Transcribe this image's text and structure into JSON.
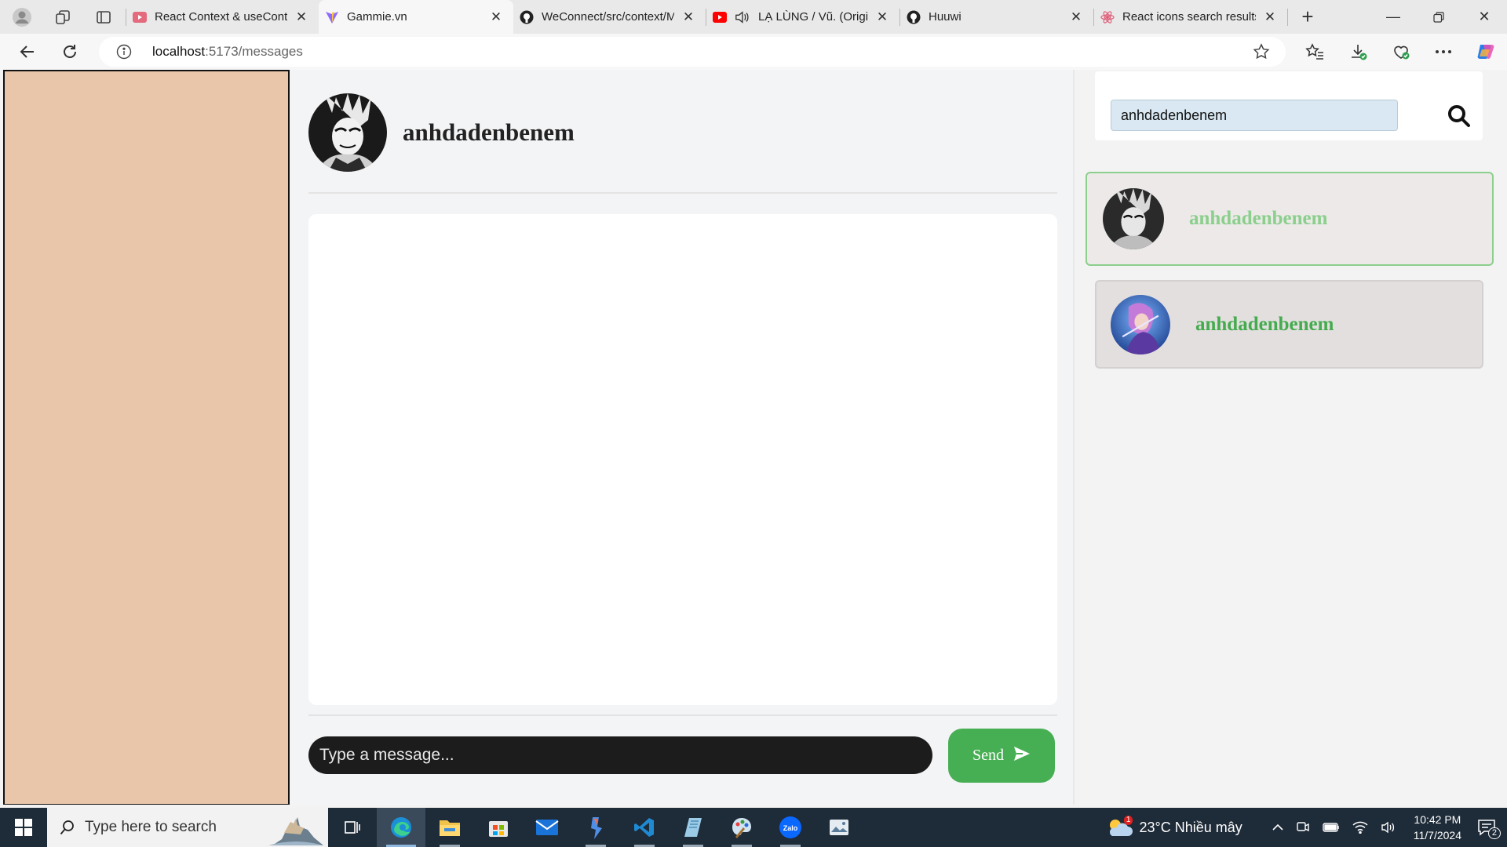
{
  "browser": {
    "tabs": [
      {
        "title": "React Context & useContext",
        "active": false,
        "icon": "youtube-icon"
      },
      {
        "title": "Gammie.vn",
        "active": true,
        "icon": "vite-icon"
      },
      {
        "title": "WeConnect/src/context/MessageContext",
        "active": false,
        "icon": "github-icon"
      },
      {
        "title": "LẠ LÙNG / Vũ. (Original)",
        "active": false,
        "icon": "youtube-icon"
      },
      {
        "title": "Huuwi",
        "active": false,
        "icon": "github-icon"
      },
      {
        "title": "React icons search results",
        "active": false,
        "icon": "react-icon"
      }
    ],
    "url_host": "localhost",
    "url_path": ":5173/messages"
  },
  "chat": {
    "header_name": "anhdadenbenem",
    "input_placeholder": "Type a message...",
    "send_label": "Send"
  },
  "search": {
    "value": "anhdadenbenem"
  },
  "contacts": [
    {
      "name": "anhdadenbenem",
      "selected": true
    },
    {
      "name": "anhdadenbenem",
      "selected": false
    }
  ],
  "taskbar": {
    "search_placeholder": "Type here to search",
    "weather": "23°C  Nhiều mây",
    "weather_badge": "1",
    "time": "10:42 PM",
    "date": "11/7/2024",
    "notifications": "2"
  },
  "colors": {
    "sidebar": "#e9c6aa",
    "accent_green": "#47af53",
    "contact_name_light": "#8bcf8d",
    "contact_name": "#45ab4f"
  }
}
